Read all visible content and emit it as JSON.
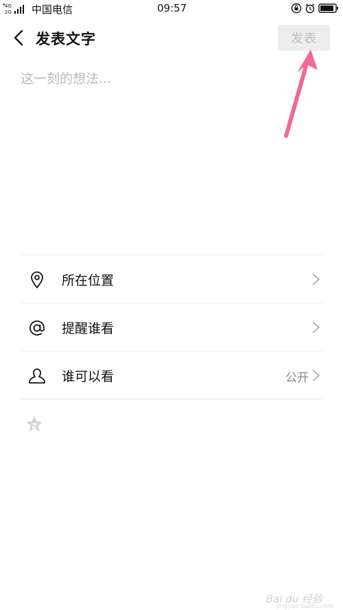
{
  "status_bar": {
    "network": "4G 2G",
    "carrier": "中国电信",
    "time": "09:57"
  },
  "header": {
    "title": "发表文字",
    "publish_label": "发表"
  },
  "editor": {
    "placeholder": "这一刻的想法..."
  },
  "options": [
    {
      "label": "所在位置",
      "icon": "location-pin-icon"
    },
    {
      "label": "提醒谁看",
      "icon": "at-icon"
    },
    {
      "label": "谁可以看",
      "value": "公开",
      "icon": "person-icon"
    }
  ],
  "watermark": {
    "text": "Bai du 经验",
    "sub": "jingyan.baidu.com"
  },
  "colors": {
    "accent_arrow": "#f2679a",
    "publish_bg": "#ededed",
    "publish_text": "#bdbdbd"
  }
}
